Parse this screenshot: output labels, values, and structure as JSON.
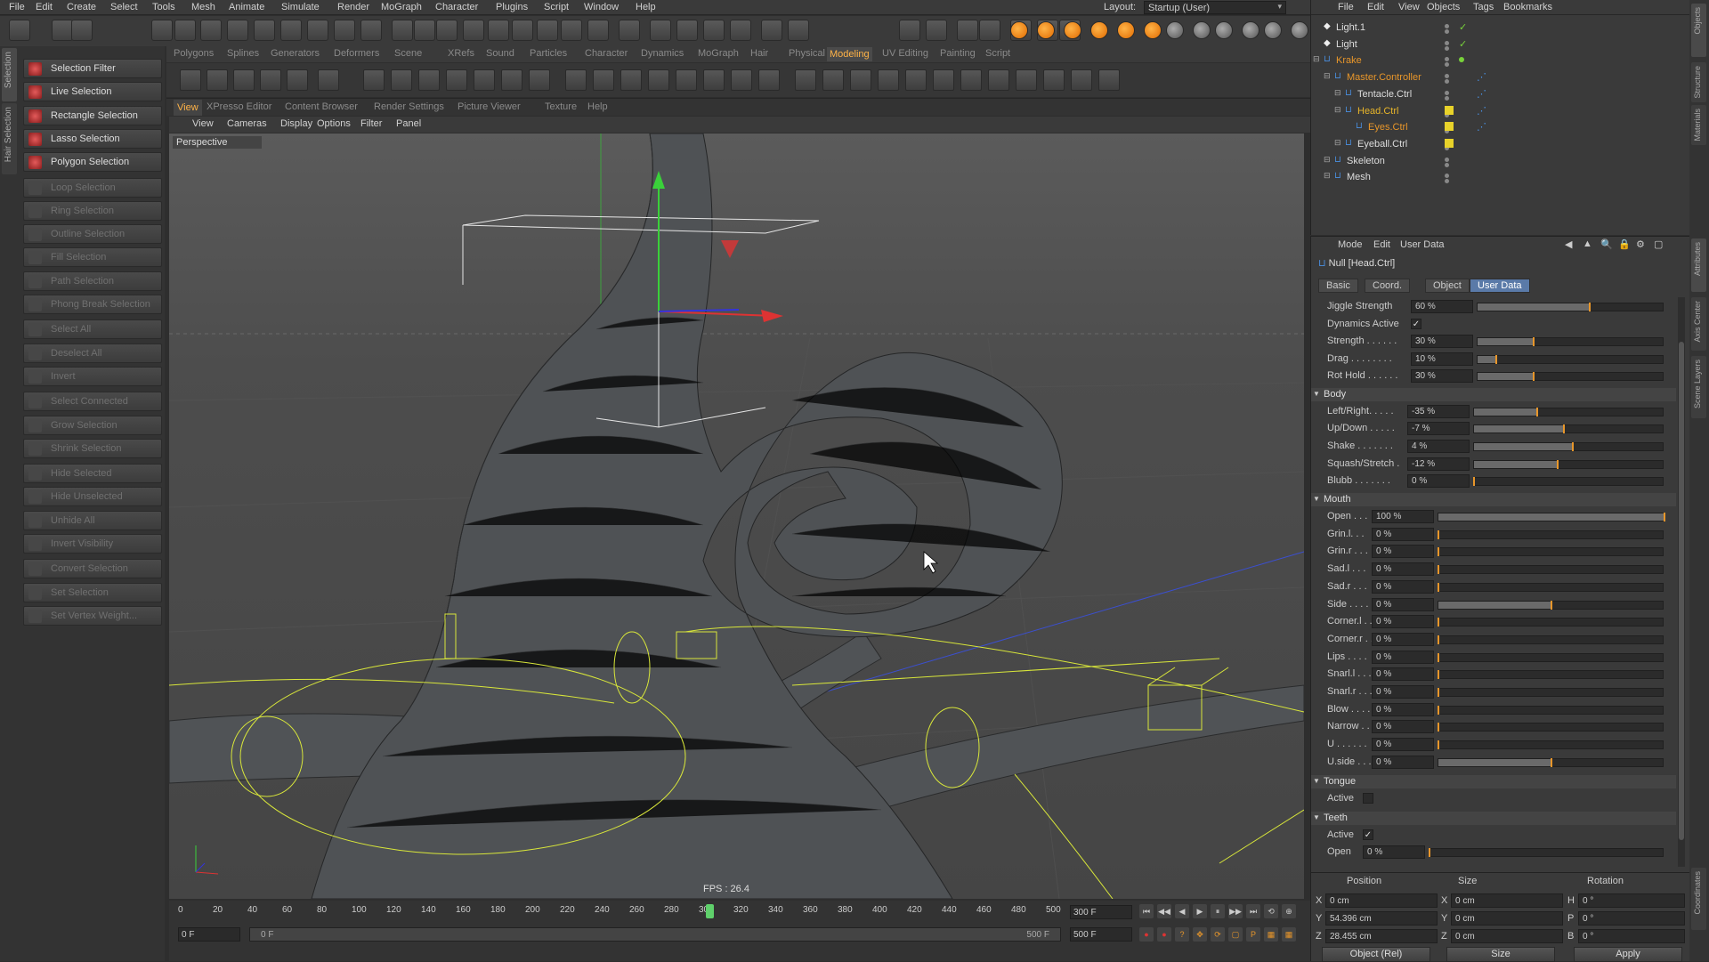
{
  "menubar": {
    "items": [
      "File",
      "Edit",
      "Create",
      "Select",
      "Tools",
      "Mesh",
      "Animate",
      "Simulate",
      "Render",
      "MoGraph",
      "Character",
      "Plugins",
      "Script",
      "Window",
      "Help"
    ],
    "layout_label": "Layout:",
    "layout_value": "Startup (User)"
  },
  "left_tabs": [
    "Selection",
    "Hair Selection"
  ],
  "selection_panel": {
    "items": [
      {
        "label": "Selection Filter",
        "active": true
      },
      {
        "label": "Live Selection",
        "active": true
      },
      {
        "label": "Rectangle Selection",
        "active": true
      },
      {
        "label": "Lasso Selection",
        "active": true
      },
      {
        "label": "Polygon Selection",
        "active": true
      },
      {
        "label": "Loop Selection",
        "active": false
      },
      {
        "label": "Ring Selection",
        "active": false
      },
      {
        "label": "Outline Selection",
        "active": false
      },
      {
        "label": "Fill Selection",
        "active": false
      },
      {
        "label": "Path Selection",
        "active": false
      },
      {
        "label": "Phong Break Selection",
        "active": false
      },
      {
        "label": "Select All",
        "active": false
      },
      {
        "label": "Deselect All",
        "active": false
      },
      {
        "label": "Invert",
        "active": false
      },
      {
        "label": "Select Connected",
        "active": false
      },
      {
        "label": "Grow Selection",
        "active": false
      },
      {
        "label": "Shrink Selection",
        "active": false
      },
      {
        "label": "Hide Selected",
        "active": false
      },
      {
        "label": "Hide Unselected",
        "active": false
      },
      {
        "label": "Unhide All",
        "active": false
      },
      {
        "label": "Invert Visibility",
        "active": false
      },
      {
        "label": "Convert Selection",
        "active": false
      },
      {
        "label": "Set Selection",
        "active": false
      },
      {
        "label": "Set Vertex Weight...",
        "active": false
      }
    ]
  },
  "mode_tabs": [
    "Polygons",
    "Splines",
    "Generators",
    "Deformers",
    "Scene",
    "XRefs",
    "Sound",
    "Particles",
    "Character",
    "Dynamics",
    "MoGraph",
    "Hair",
    "Physical Sky",
    "Modeling",
    "UV Editing",
    "Painting",
    "Script"
  ],
  "mode_active": "Modeling",
  "view_tabs": [
    "View",
    "XPresso Editor",
    "Content Browser",
    "Render Settings",
    "Picture Viewer",
    "Texture",
    "Help"
  ],
  "view_active": "View",
  "view_menu": [
    "View",
    "Cameras",
    "Display",
    "Options",
    "Filter",
    "Panel"
  ],
  "viewport": {
    "label": "Perspective",
    "fps": "FPS : 26.4"
  },
  "timeline": {
    "ticks": [
      "0",
      "20",
      "40",
      "60",
      "80",
      "100",
      "120",
      "140",
      "160",
      "180",
      "200",
      "220",
      "240",
      "260",
      "280",
      "300",
      "320",
      "340",
      "360",
      "380",
      "400",
      "420",
      "440",
      "460",
      "480",
      "500"
    ],
    "current_frame": 306,
    "end_field": "300 F",
    "start_field": "0 F",
    "range_start": "0 F",
    "range_end": "500 F",
    "max_field": "500 F"
  },
  "object_manager": {
    "menu": [
      "File",
      "Edit",
      "View",
      "Objects",
      "Tags",
      "Bookmarks"
    ],
    "objects": [
      {
        "name": "Light.1",
        "color": "normal",
        "indent": 0
      },
      {
        "name": "Light",
        "color": "normal",
        "indent": 0
      },
      {
        "name": "Krake",
        "color": "orange",
        "indent": 0
      },
      {
        "name": "Master.Controller",
        "color": "orange",
        "indent": 1
      },
      {
        "name": "Tentacle.Ctrl",
        "color": "normal",
        "indent": 2
      },
      {
        "name": "Head.Ctrl",
        "color": "yellow",
        "indent": 2
      },
      {
        "name": "Eyes.Ctrl",
        "color": "orange",
        "indent": 3
      },
      {
        "name": "Eyeball.Ctrl",
        "color": "normal",
        "indent": 2
      },
      {
        "name": "Skeleton",
        "color": "normal",
        "indent": 1
      },
      {
        "name": "Mesh",
        "color": "normal",
        "indent": 1
      }
    ]
  },
  "attributes": {
    "menu": [
      "Mode",
      "Edit",
      "User Data"
    ],
    "title": "Null [Head.Ctrl]",
    "tabs": [
      "Basic",
      "Coord.",
      "Object",
      "User Data"
    ],
    "tab_active": "User Data",
    "top_params": [
      {
        "label": "Jiggle Strength",
        "value": "60 %",
        "frac": 0.6,
        "type": "slider"
      },
      {
        "label": "Dynamics Active",
        "value": "✓",
        "type": "check"
      },
      {
        "label": "Strength . . . . . .",
        "value": "30 %",
        "frac": 0.3,
        "type": "slider"
      },
      {
        "label": "Drag . . . . . . . .",
        "value": "10 %",
        "frac": 0.1,
        "type": "slider"
      },
      {
        "label": "Rot Hold . . . . . .",
        "value": "30 %",
        "frac": 0.3,
        "type": "slider"
      }
    ],
    "body_title": "Body",
    "body_params": [
      {
        "label": "Left/Right. . . . .",
        "value": "-35 %",
        "frac": 0.33
      },
      {
        "label": "Up/Down . . . . .",
        "value": "-7 %",
        "frac": 0.47
      },
      {
        "label": "Shake . . . . . . .",
        "value": "4 %",
        "frac": 0.52
      },
      {
        "label": "Squash/Stretch .",
        "value": "-12 %",
        "frac": 0.44
      },
      {
        "label": "Blubb . . . . . . .",
        "value": "0 %",
        "frac": 0.0
      }
    ],
    "mouth_title": "Mouth",
    "mouth_params": [
      {
        "label": "Open . . .",
        "value": "100 %",
        "frac": 1.0
      },
      {
        "label": "Grin.l. . .",
        "value": "0 %",
        "frac": 0.0
      },
      {
        "label": "Grin.r . . .",
        "value": "0 %",
        "frac": 0.0
      },
      {
        "label": "Sad.l . . .",
        "value": "0 %",
        "frac": 0.0
      },
      {
        "label": "Sad.r . . .",
        "value": "0 %",
        "frac": 0.0
      },
      {
        "label": "Side . . . .",
        "value": "0 %",
        "frac": 0.5
      },
      {
        "label": "Corner.l . .",
        "value": "0 %",
        "frac": 0.0
      },
      {
        "label": "Corner.r . .",
        "value": "0 %",
        "frac": 0.0
      },
      {
        "label": "Lips . . . .",
        "value": "0 %",
        "frac": 0.0
      },
      {
        "label": "Snarl.l . . .",
        "value": "0 %",
        "frac": 0.0
      },
      {
        "label": "Snarl.r . . .",
        "value": "0 %",
        "frac": 0.0
      },
      {
        "label": "Blow . . . .",
        "value": "0 %",
        "frac": 0.0
      },
      {
        "label": "Narrow . . .",
        "value": "0 %",
        "frac": 0.0
      },
      {
        "label": "U . . . . . .",
        "value": "0 %",
        "frac": 0.0
      },
      {
        "label": "U.side . . .",
        "value": "0 %",
        "frac": 0.5
      }
    ],
    "tongue_title": "Tongue",
    "tongue_active_label": "Active",
    "teeth_title": "Teeth",
    "teeth_active_label": "Active",
    "teeth_open_label": "Open",
    "teeth_open_value": "0 %"
  },
  "coordinates": {
    "headers": [
      "Position",
      "Size",
      "Rotation"
    ],
    "rows": [
      {
        "axis": "X",
        "pos": "0 cm",
        "saxis": "X",
        "size": "0 cm",
        "raxis": "H",
        "rot": "0 °"
      },
      {
        "axis": "Y",
        "pos": "54.396 cm",
        "saxis": "Y",
        "size": "0 cm",
        "raxis": "P",
        "rot": "0 °"
      },
      {
        "axis": "Z",
        "pos": "28.455 cm",
        "saxis": "Z",
        "size": "0 cm",
        "raxis": "B",
        "rot": "0 °"
      }
    ],
    "mode": "Object (Rel)",
    "size_mode": "Size",
    "apply": "Apply"
  },
  "right_tabs": [
    "Objects",
    "Structure",
    "Materials",
    "Attributes",
    "Axis Center",
    "Scene Layers",
    "Coordinates"
  ],
  "colors": {
    "accent": "#ffb347",
    "selected_tab": "#5a7aa8",
    "mesh": "#505356",
    "wire_yellow": "#d8e63a"
  }
}
